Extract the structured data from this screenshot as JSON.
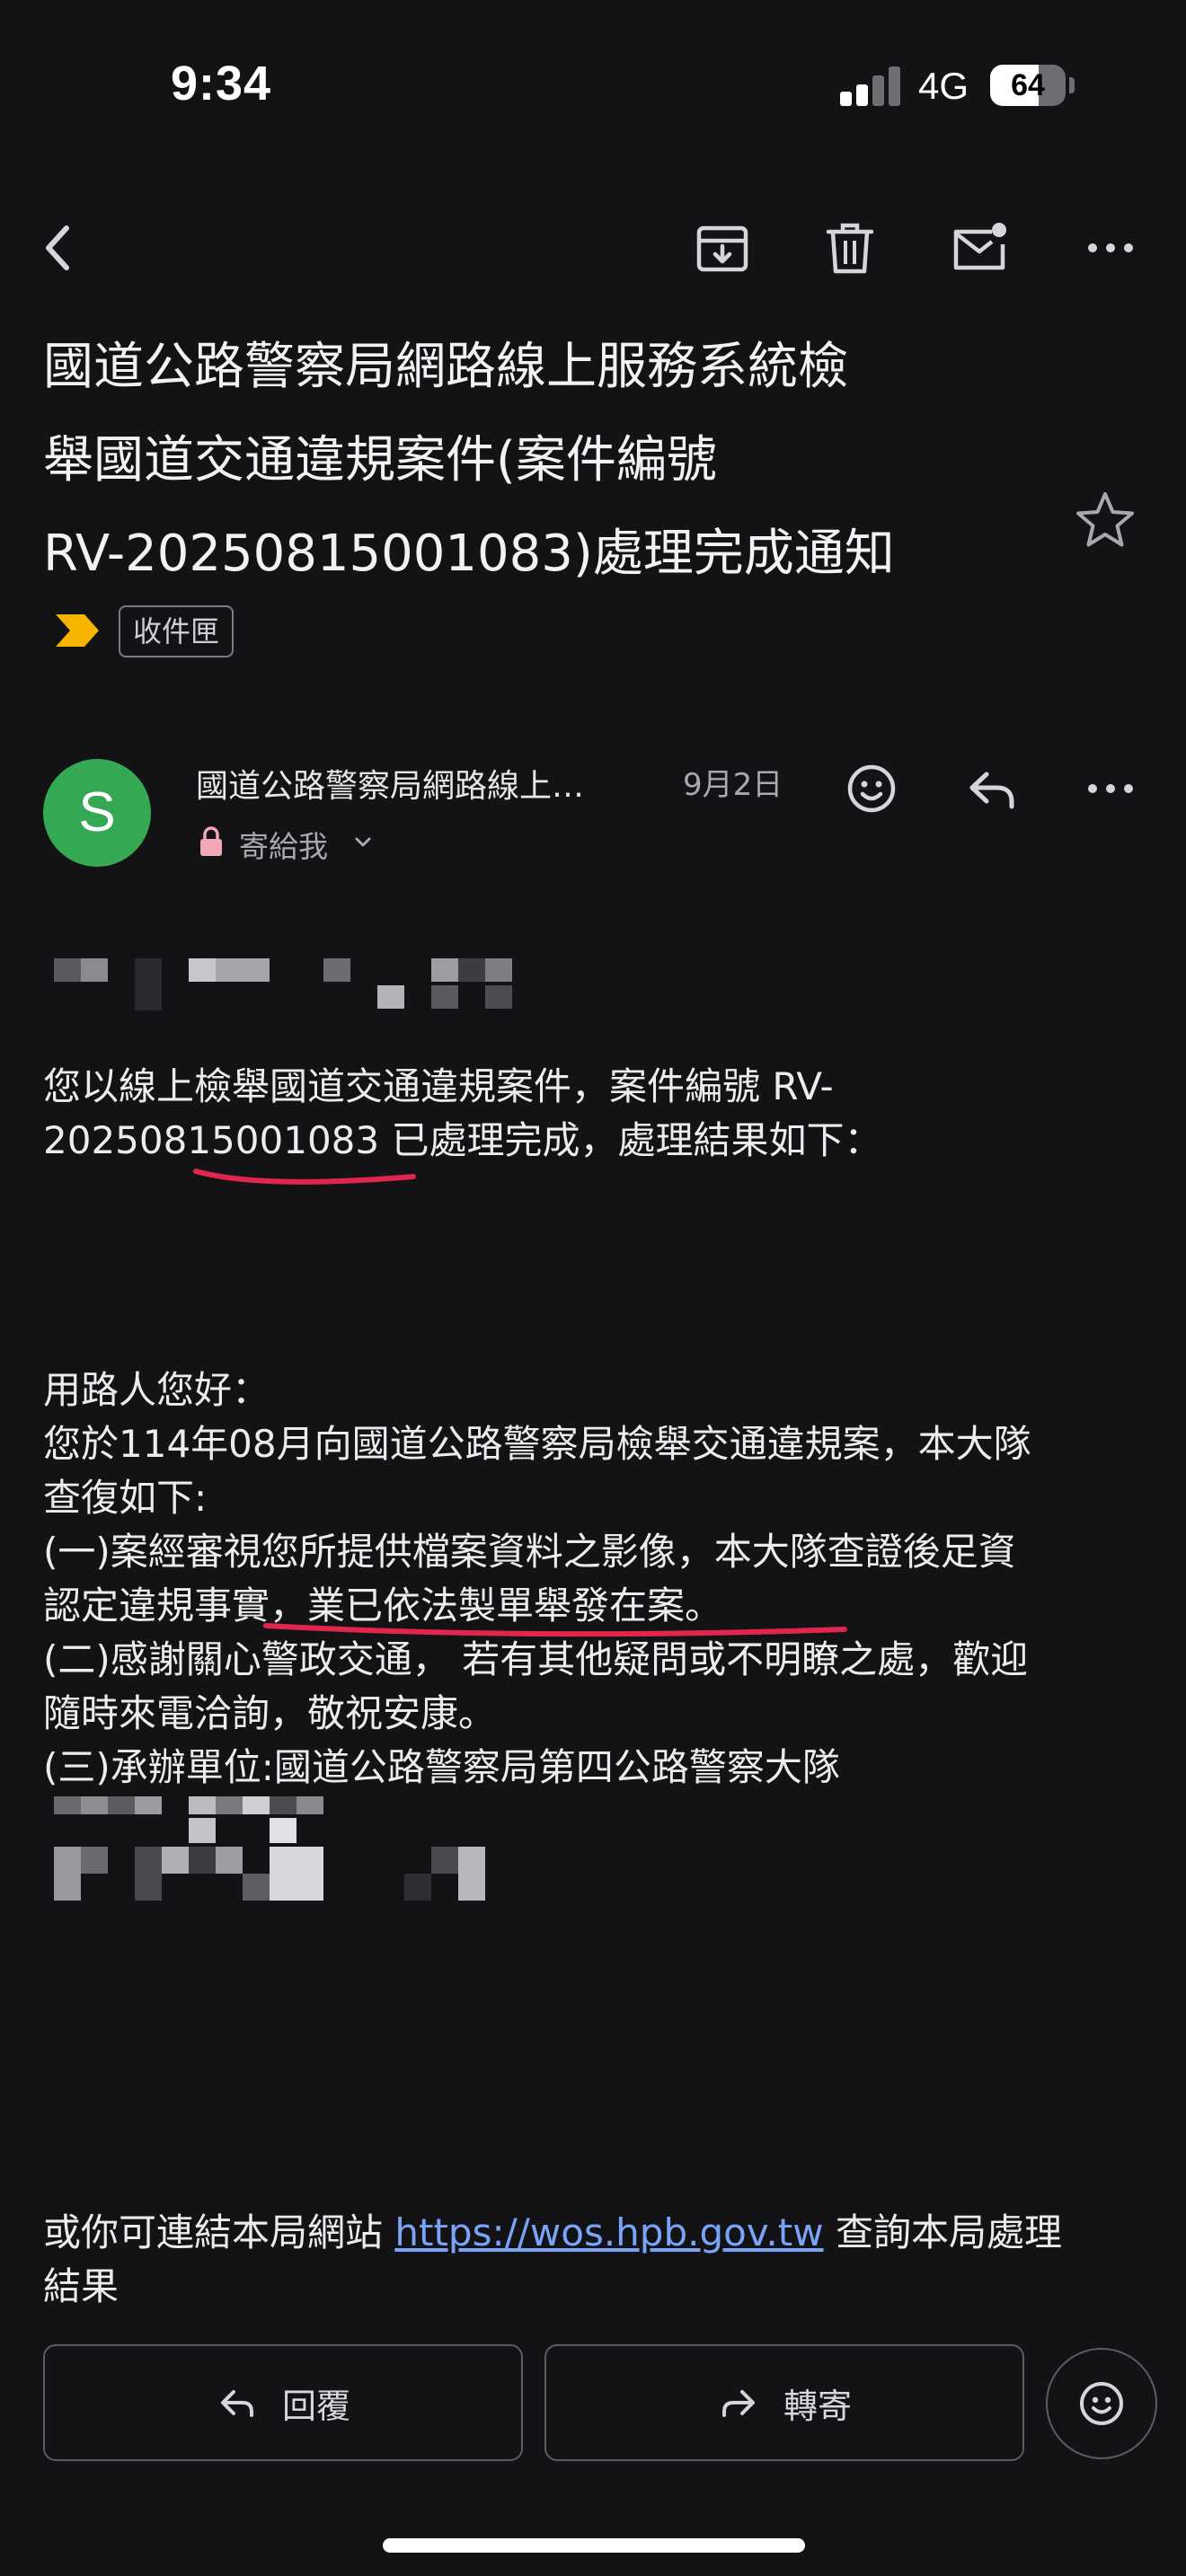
{
  "status_bar": {
    "time": "9:34",
    "network": "4G",
    "battery": "64",
    "battery_level": 0.64
  },
  "toolbar": {
    "back_icon": "chevron-left-icon",
    "archive_icon": "archive-icon",
    "delete_icon": "trash-icon",
    "mark_unread_icon": "mail-unread-icon",
    "more_icon": "more-horizontal-icon"
  },
  "email": {
    "subject_lines": [
      "國道公路警察局網路線上服務系統檢",
      "舉國道交通違規案件(案件編號",
      "RV-20250815001083)處理完成通知"
    ],
    "label": "收件匣",
    "sender": {
      "avatar_letter": "S",
      "avatar_color": "#34a853",
      "name": "國道公路警察局網路線上…",
      "date": "9月2日",
      "to": "寄給我"
    },
    "body": {
      "intro_lines": [
        "您以線上檢舉國道交通違規案件，案件編號 RV-",
        "20250815001083 已處理完成，處理結果如下："
      ],
      "result_lines": [
        "用路人您好：",
        "您於114年08月向國道公路警察局檢舉交通違規案，本大隊",
        "查復如下:",
        "(一)案經審視您所提供檔案資料之影像，本大隊查證後足資",
        "認定違規事實，業已依法製單舉發在案。",
        "(二)感謝關心警政交通， 若有其他疑問或不明瞭之處，歡迎",
        "隨時來電洽詢，敬祝安康。",
        "(三)承辦單位:國道公路警察局第四公路警察大隊"
      ],
      "footer_prefix": "或你可連結本局網站 ",
      "footer_link": "https://wos.hpb.gov.tw",
      "footer_suffix": " 查詢本局處理",
      "footer_line2": "結果"
    }
  },
  "actions": {
    "reply_label": "回覆",
    "forward_label": "轉寄"
  },
  "colors": {
    "background": "#131316",
    "link": "#7aa4f7",
    "annotation_ink": "#e0264f",
    "important_marker": "#f4b400"
  }
}
